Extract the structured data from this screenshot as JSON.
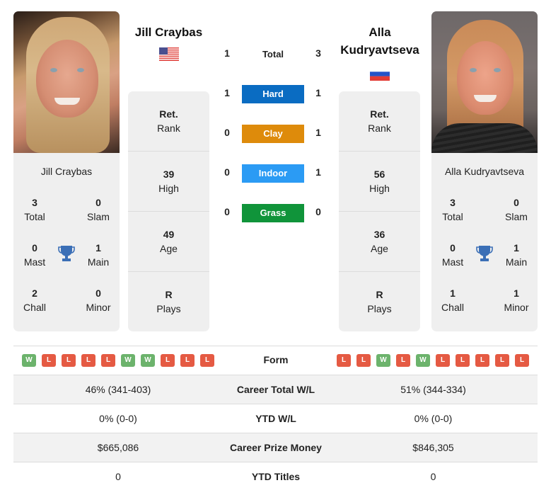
{
  "players": {
    "left": {
      "name": "Jill Craybas",
      "card_name": "Jill Craybas",
      "country": "USA",
      "flag_icon": "usa-flag-icon",
      "titles": {
        "total": {
          "value": "3",
          "label": "Total"
        },
        "slam": {
          "value": "0",
          "label": "Slam"
        },
        "mast": {
          "value": "0",
          "label": "Mast"
        },
        "main": {
          "value": "1",
          "label": "Main"
        },
        "chall": {
          "value": "2",
          "label": "Chall"
        },
        "minor": {
          "value": "0",
          "label": "Minor"
        }
      },
      "info": {
        "rank": {
          "value": "Ret.",
          "label": "Rank"
        },
        "high": {
          "value": "39",
          "label": "High"
        },
        "age": {
          "value": "49",
          "label": "Age"
        },
        "plays": {
          "value": "R",
          "label": "Plays"
        }
      },
      "form": [
        "W",
        "L",
        "L",
        "L",
        "L",
        "W",
        "W",
        "L",
        "L",
        "L"
      ]
    },
    "right": {
      "name": "Alla Kudryavtseva",
      "name_line1": "Alla",
      "name_line2": "Kudryavtseva",
      "card_name": "Alla Kudryavtseva",
      "country": "Russia",
      "flag_icon": "russia-flag-icon",
      "titles": {
        "total": {
          "value": "3",
          "label": "Total"
        },
        "slam": {
          "value": "0",
          "label": "Slam"
        },
        "mast": {
          "value": "0",
          "label": "Mast"
        },
        "main": {
          "value": "1",
          "label": "Main"
        },
        "chall": {
          "value": "1",
          "label": "Chall"
        },
        "minor": {
          "value": "1",
          "label": "Minor"
        }
      },
      "info": {
        "rank": {
          "value": "Ret.",
          "label": "Rank"
        },
        "high": {
          "value": "56",
          "label": "High"
        },
        "age": {
          "value": "36",
          "label": "Age"
        },
        "plays": {
          "value": "R",
          "label": "Plays"
        }
      },
      "form": [
        "L",
        "L",
        "W",
        "L",
        "W",
        "L",
        "L",
        "L",
        "L",
        "L"
      ]
    }
  },
  "h2h": {
    "total": {
      "label": "Total",
      "left": "1",
      "right": "3"
    },
    "surfaces": [
      {
        "label": "Hard",
        "left": "1",
        "right": "1",
        "color": "#0a6cc2"
      },
      {
        "label": "Clay",
        "left": "0",
        "right": "1",
        "color": "#de8b0b"
      },
      {
        "label": "Indoor",
        "left": "0",
        "right": "1",
        "color": "#2b9bf4"
      },
      {
        "label": "Grass",
        "left": "0",
        "right": "0",
        "color": "#10943a"
      }
    ]
  },
  "form_label": "Form",
  "stats": [
    {
      "label": "Career Total W/L",
      "left": "46% (341-403)",
      "right": "51% (344-334)"
    },
    {
      "label": "YTD W/L",
      "left": "0% (0-0)",
      "right": "0% (0-0)"
    },
    {
      "label": "Career Prize Money",
      "left": "$665,086",
      "right": "$846,305"
    },
    {
      "label": "YTD Titles",
      "left": "0",
      "right": "0"
    }
  ],
  "colors": {
    "win": "#6cb36c",
    "loss": "#e55a43",
    "trophy": "#3b6fb6",
    "panel": "#efefef"
  }
}
